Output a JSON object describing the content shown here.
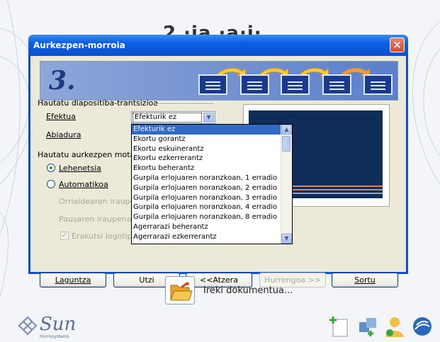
{
  "background": {
    "title_fragment": "2 ·ia ·a·i·"
  },
  "dialog": {
    "title": "Aurkezpen-morroia",
    "step_number": "3.",
    "transition_group": "Hautatu diapositiba-trantsizioa",
    "effect_label": "Efektua",
    "speed_label": "Abiadura",
    "effect_value": "Efekturik ez",
    "effect_options": [
      "Efekturik ez",
      "Ekortu gorantz",
      "Ekortu eskuinerantz",
      "Ekortu ezkerrerantz",
      "Ekortu beherantz",
      "Gurpila erlojuaren noranzkoan, 1 erradio",
      "Gurpila erlojuaren noranzkoan, 2 erradio",
      "Gurpila erlojuaren noranzkoan, 3 erradio",
      "Gurpila erlojuaren noranzkoan, 4 erradio",
      "Gurpila erlojuaren noranzkoan, 8 erradio",
      "Agerrarazi beherantz",
      "Agerrarazi ezkerrerantz"
    ],
    "presentation_group": "Hautatu aurkezpen mota",
    "radio_default": "Lehenetsia",
    "radio_auto": "Automatikoa",
    "page_duration_label": "Orrialdearen iraupena",
    "pause_duration_label": "Pausaren iraupena",
    "show_logo_label": "Erakutsi logotipoa",
    "buttons": {
      "help": "Laguntza",
      "cancel": "Utzi",
      "back": "<<Atzera",
      "next": "Hurrengoa >>",
      "create": "Sortu"
    }
  },
  "open_document": "Ireki dokumentua...",
  "sun": {
    "logo": "Sun",
    "sub": "microsystems"
  },
  "icons": [
    "new-document-icon",
    "extensions-icon",
    "user-icon",
    "openoffice-icon"
  ],
  "colors": {
    "title_bar": "#0a50d8",
    "selection": "#316ac5",
    "close": "#d84a26"
  }
}
